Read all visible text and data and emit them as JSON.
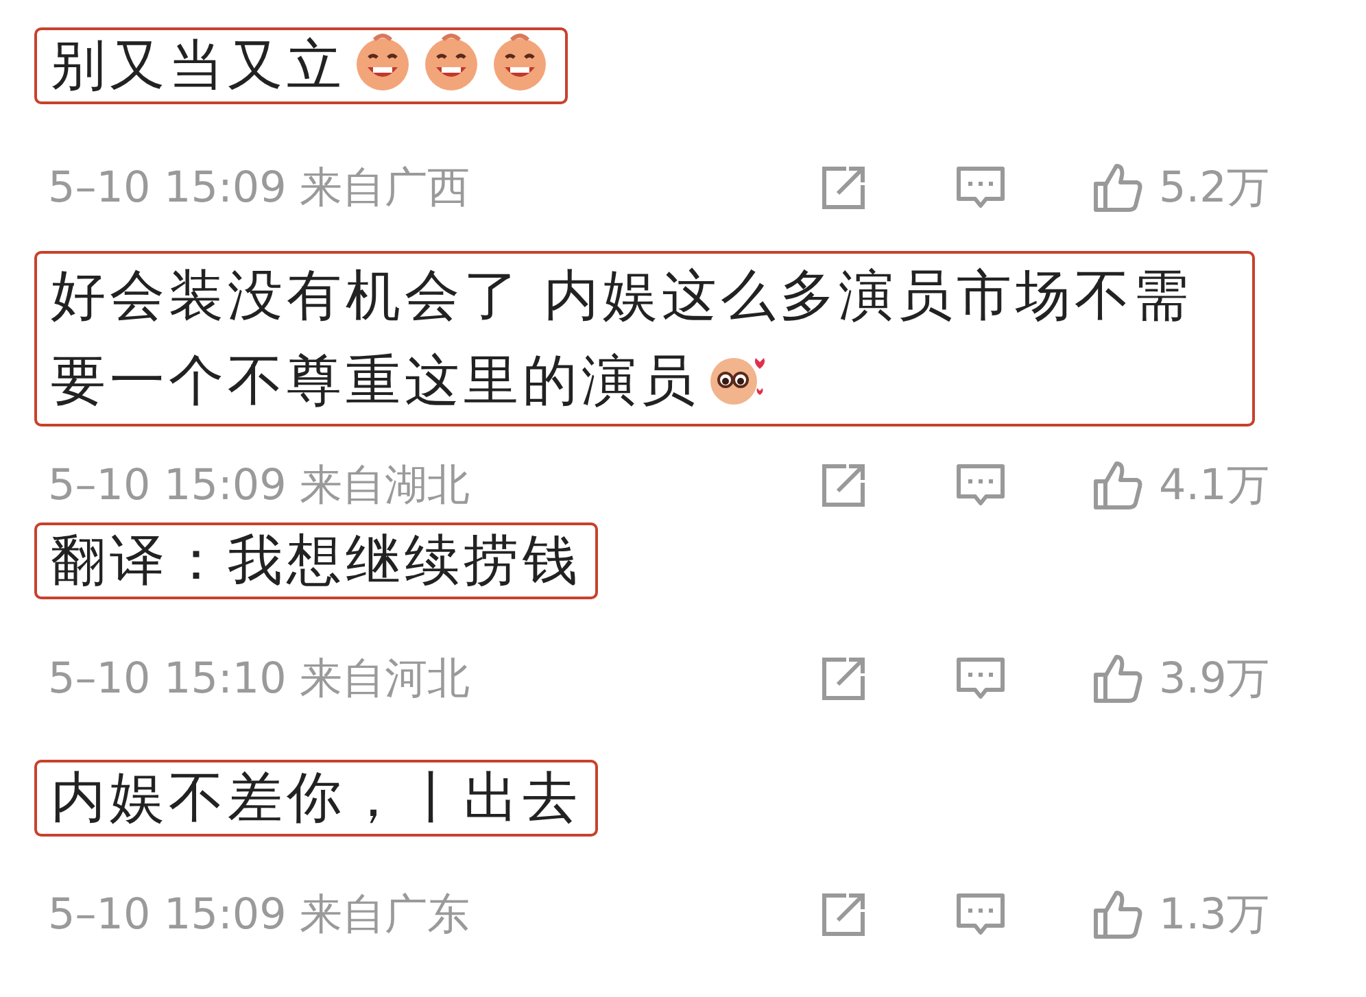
{
  "comments": [
    {
      "text": "别又当又立",
      "emojis": [
        {
          "kind": "grin"
        },
        {
          "kind": "grin"
        },
        {
          "kind": "grin"
        }
      ],
      "time": "5–10 15:09",
      "location": "来自广西",
      "likes": "5.2万"
    },
    {
      "text": "好会装没有机会了 内娱这么多演员市场不需要一个不尊重这里的演员",
      "emojis": [
        {
          "kind": "shy"
        }
      ],
      "time": "5–10 15:09",
      "location": "来自湖北",
      "likes": "4.1万"
    },
    {
      "text": "翻译：我想继续捞钱",
      "time": "5–10 15:10",
      "location": "来自河北",
      "likes": "3.9万"
    },
    {
      "text": "内娱不差你，丨出去",
      "time": "5–10 15:09",
      "location": "来自广东",
      "likes": "1.3万"
    }
  ]
}
